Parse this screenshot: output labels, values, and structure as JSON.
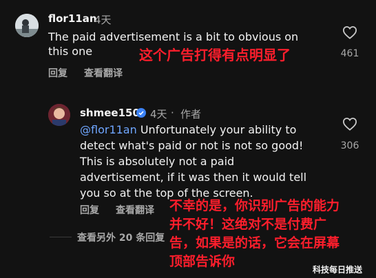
{
  "comment1": {
    "username": "flor11an",
    "time": "4天",
    "text_line1": "The paid advertisement is a bit to obvious on",
    "text_line2": "this one",
    "likes": "461",
    "reply_label": "回复",
    "translate_label": "查看翻译",
    "overlay": "这个广告打得有点明显了"
  },
  "comment2": {
    "username": "shmee150",
    "time": "4天",
    "author_badge": "作者",
    "mention": "@flor11an",
    "text_line1_rest": " Unfortunately your ability to",
    "text_line2": "detect what's paid or not is not so good!",
    "text_line3": "This is absolutely not a paid",
    "text_line4": "advertisement, if it was then it would tell",
    "text_line5": "you so at the top of the screen.",
    "likes": "306",
    "reply_label": "回复",
    "translate_label": "查看翻译",
    "overlay_lines": [
      "不幸的是，你识别广告的能力",
      "并不好！这绝对不是付费广",
      "告，如果是的话，它会在屏幕",
      "顶部告诉你"
    ]
  },
  "more_replies": "查看另外 20 条回复",
  "watermark": "科技每日推送",
  "colors": {
    "mention": "#6fa6ff",
    "overlay": "#ff1e2c",
    "verified": "#3b82f6"
  }
}
